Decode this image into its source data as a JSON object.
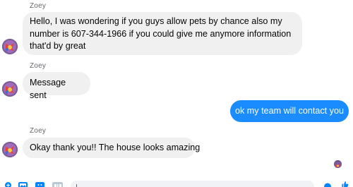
{
  "conversation": {
    "messages": [
      {
        "direction": "incoming",
        "sender": "Zoey",
        "text_lines": [
          "Hello, I was wondering if you guys allow pets by chance also my",
          "number is 607-344-1966 if you could give me anymore information",
          "that'd by great"
        ]
      },
      {
        "direction": "incoming",
        "sender": "Zoey",
        "text": "Message sent"
      },
      {
        "direction": "outgoing",
        "text": "ok my team will contact you"
      },
      {
        "direction": "incoming",
        "sender": "Zoey",
        "text": "Okay thank you!! The house looks amazing"
      }
    ]
  },
  "colors": {
    "incoming_bubble": "#f0f0f0",
    "outgoing_bubble": "#1a8cff",
    "sender_name": "#65676b",
    "composer_background": "#f0f2f5",
    "messenger_blue": "#0084ff"
  },
  "composer": {
    "icons": [
      "add-icon",
      "image-icon",
      "sticker-icon",
      "gif-icon",
      "like-icon"
    ],
    "message_value": ""
  }
}
